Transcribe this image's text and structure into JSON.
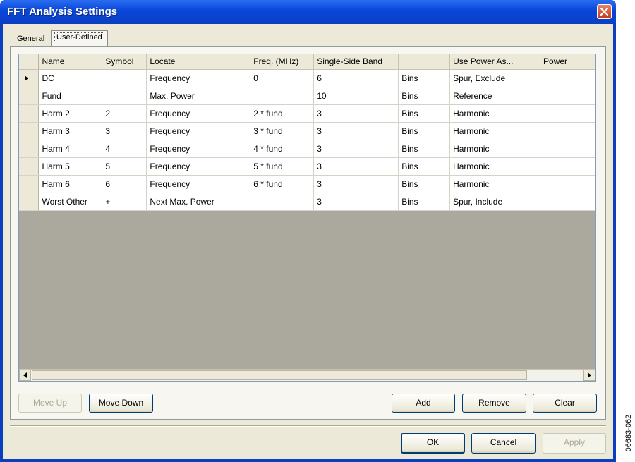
{
  "window": {
    "title": "FFT Analysis Settings"
  },
  "tabs": [
    {
      "label": "General",
      "active": false
    },
    {
      "label": "User-Defined",
      "active": true
    }
  ],
  "grid": {
    "columns": [
      "Name",
      "Symbol",
      "Locate",
      "Freq. (MHz)",
      "Single-Side Band",
      "",
      "Use Power As...",
      "Power"
    ],
    "rows": [
      {
        "selected": true,
        "cells": [
          "DC",
          "",
          "Frequency",
          "0",
          "6",
          "Bins",
          "Spur, Exclude",
          ""
        ]
      },
      {
        "selected": false,
        "cells": [
          "Fund",
          "",
          "Max. Power",
          "",
          "10",
          "Bins",
          "Reference",
          ""
        ]
      },
      {
        "selected": false,
        "cells": [
          "Harm 2",
          "2",
          "Frequency",
          "2 * fund",
          "3",
          "Bins",
          "Harmonic",
          ""
        ]
      },
      {
        "selected": false,
        "cells": [
          "Harm 3",
          "3",
          "Frequency",
          "3 * fund",
          "3",
          "Bins",
          "Harmonic",
          ""
        ]
      },
      {
        "selected": false,
        "cells": [
          "Harm 4",
          "4",
          "Frequency",
          "4 * fund",
          "3",
          "Bins",
          "Harmonic",
          ""
        ]
      },
      {
        "selected": false,
        "cells": [
          "Harm 5",
          "5",
          "Frequency",
          "5 * fund",
          "3",
          "Bins",
          "Harmonic",
          ""
        ]
      },
      {
        "selected": false,
        "cells": [
          "Harm 6",
          "6",
          "Frequency",
          "6 * fund",
          "3",
          "Bins",
          "Harmonic",
          ""
        ]
      },
      {
        "selected": false,
        "cells": [
          "Worst Other",
          "+",
          "Next Max. Power",
          "",
          "3",
          "Bins",
          "Spur, Include",
          ""
        ]
      }
    ]
  },
  "panel_buttons": {
    "move_up": "Move Up",
    "move_down": "Move Down",
    "add": "Add",
    "remove": "Remove",
    "clear": "Clear"
  },
  "dialog_buttons": {
    "ok": "OK",
    "cancel": "Cancel",
    "apply": "Apply"
  },
  "figure_id": "06683-062",
  "colors": {
    "titlebar": "#0846d8",
    "dialog_face": "#ece9d8",
    "grid_empty": "#aba99e",
    "close": "#c5391a"
  },
  "icons": [
    "close-icon",
    "row-pointer-icon",
    "scroll-left-icon",
    "scroll-right-icon"
  ]
}
